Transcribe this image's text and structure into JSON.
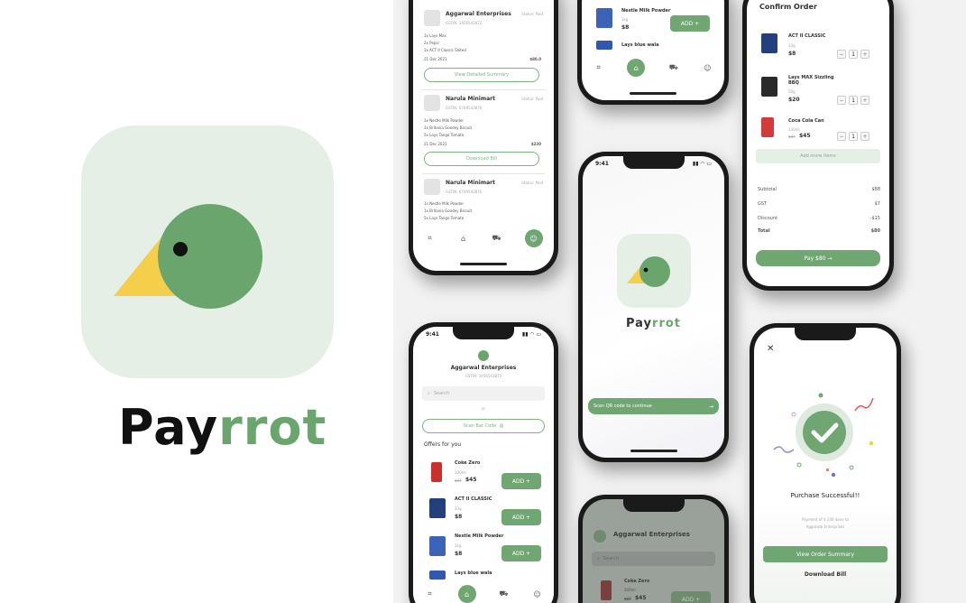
{
  "brand": {
    "name_part1": "Pay",
    "name_part2": "rrot",
    "accent": "#6aa56d",
    "icon_bg": "#e6efe6",
    "beak": "#f5cf4a"
  },
  "status_time": "9:41",
  "history": {
    "orders": [
      {
        "store": "Aggarwal Enterprises",
        "gstin": "GSTIN: 3456543872",
        "status": "Status: Paid",
        "items": [
          "1x Lays Max",
          "2x Pepsi",
          "1x ACT II Classic Salted"
        ],
        "date": "21 Dec 2021",
        "amount": "$80.0",
        "button": "View Detailed Summary"
      },
      {
        "store": "Narula Minimart",
        "gstin": "GSTIN: 6789543876",
        "status": "Status: Paid",
        "items": [
          "1x Nestle Milk Powder",
          "1x Britania Goodey Biscuit",
          "5x Lays Tango Tomato"
        ],
        "date": "21 Dec 2021",
        "amount": "$230",
        "button": "Download Bill"
      },
      {
        "store": "Narula Minimart",
        "gstin": "GSTIN: 6789543876",
        "status": "Status: Paid",
        "items": [
          "1x Nestle Milk Powder",
          "1x Britania Goodey Biscuit",
          "5x Lays Tango Tomato"
        ]
      }
    ]
  },
  "shop_top": {
    "items": [
      {
        "name": "Nestle Milk Powder",
        "weight": "1kg",
        "price": "$8",
        "add": "ADD"
      },
      {
        "name": "Lays blue wala"
      }
    ]
  },
  "confirm": {
    "title": "Confirm Order",
    "items": [
      {
        "name": "ACT II CLASSIC",
        "weight": "33g",
        "price": "$8",
        "qty": "1"
      },
      {
        "name": "Lays MAX Sizzling BBQ",
        "weight": "50g",
        "price": "$20",
        "qty": "1"
      },
      {
        "name": "Coca Cola Can",
        "weight": "330ml",
        "old_price": "$47",
        "price": "$45",
        "qty": "1"
      }
    ],
    "add_more": "Add more items",
    "summary": [
      {
        "label": "Subtotal",
        "value": "$88"
      },
      {
        "label": "GST",
        "value": "$7"
      },
      {
        "label": "Discount",
        "value": "-$15"
      },
      {
        "label": "Total",
        "value": "$80"
      }
    ],
    "pay": "Pay $80"
  },
  "splash": {
    "brand_part1": "Pay",
    "brand_part2": "rrot",
    "scan": "Scan QR code to continue"
  },
  "store_home": {
    "store": "Aggarwal Enterprises",
    "gstin": "GSTIN: 3456543872",
    "search_placeholder": "Search",
    "or": "or",
    "scan_barcode": "Scan Bar Code",
    "offers_title": "Offers for you",
    "offers": [
      {
        "name": "Coke Zero",
        "weight": "200ml",
        "old_price": "$47",
        "price": "$45",
        "add": "ADD"
      },
      {
        "name": "ACT II CLASSIC",
        "weight": "33g",
        "price": "$8",
        "add": "ADD"
      },
      {
        "name": "Nestle Milk Powder",
        "weight": "1kg",
        "price": "$8",
        "add": "ADD"
      },
      {
        "name": "Lays blue wala"
      }
    ]
  },
  "success": {
    "title": "Purchase Successful!!",
    "desc_line1": "Payment of $ 140 done to",
    "desc_line2": "Aggarwal Enterprises",
    "view_summary": "View Order Summary",
    "download": "Download Bill"
  },
  "store_dim": {
    "store": "Aggarwal Enterprises",
    "search": "Search",
    "item_name": "Coke Zero",
    "item_weight": "200ml",
    "old_price": "$47",
    "price": "$45",
    "add": "ADD"
  }
}
